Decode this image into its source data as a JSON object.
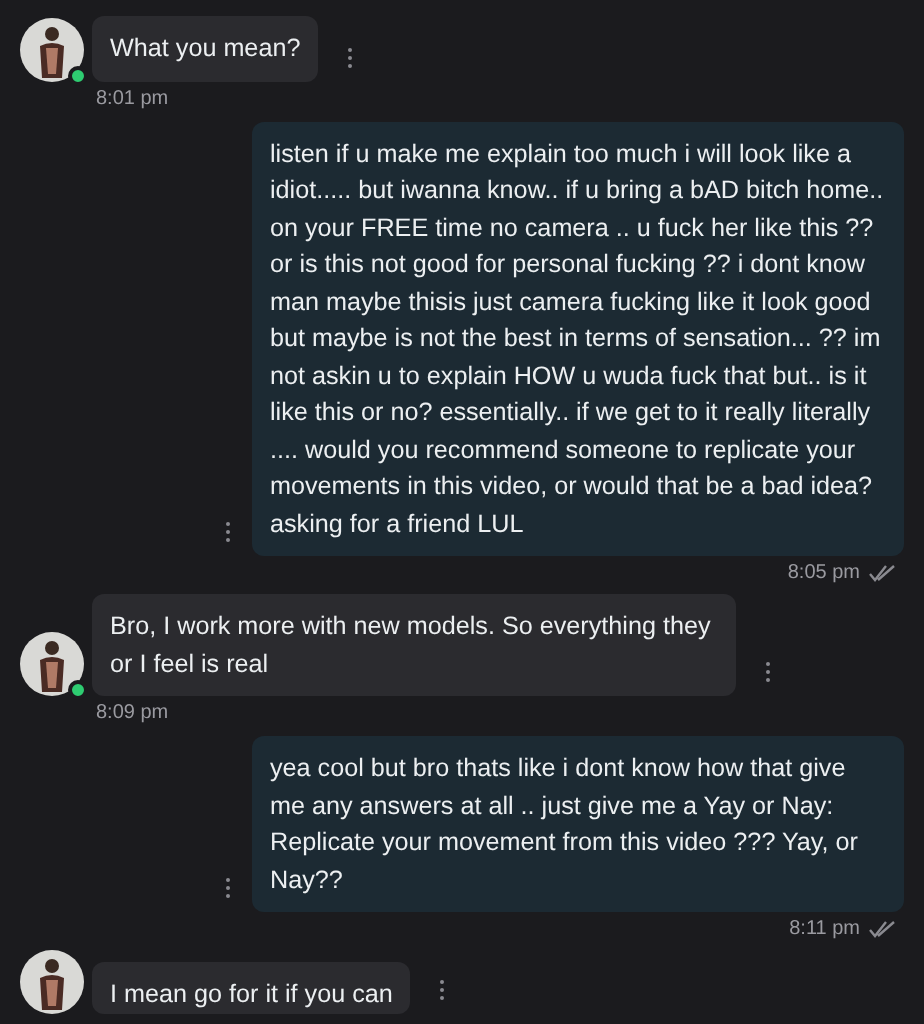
{
  "messages": [
    {
      "kind": "incoming",
      "text": "What you mean?",
      "time": "8:01 pm",
      "online": true
    },
    {
      "kind": "outgoing",
      "text": "listen if u make me explain too much i will look like a idiot..... but iwanna know.. if u bring a bAD bitch home.. on your FREE time no camera .. u fuck her like this ?? or is this not good for personal fucking ?? i dont know man maybe thisis just camera fucking like it look good but maybe is not the best in terms of sensation... ?? im not askin u to explain HOW u wuda fuck that but.. is it like this or no? essentially.. if we get to it really literally .... would you recommend someone to replicate your movements in this video, or would that be a bad idea? asking for a friend LUL",
      "time": "8:05 pm",
      "read": true
    },
    {
      "kind": "incoming",
      "text": "Bro, I work more with new models. So everything they or I feel is real",
      "time": "8:09 pm",
      "online": true
    },
    {
      "kind": "outgoing",
      "text": "yea cool but bro thats like i dont know how that give me any answers at all .. just give me a Yay or Nay: Replicate your movement from this video ??? Yay, or Nay??",
      "time": "8:11 pm",
      "read": true
    },
    {
      "kind": "incoming",
      "text": "I mean go for it if you can"
    }
  ]
}
